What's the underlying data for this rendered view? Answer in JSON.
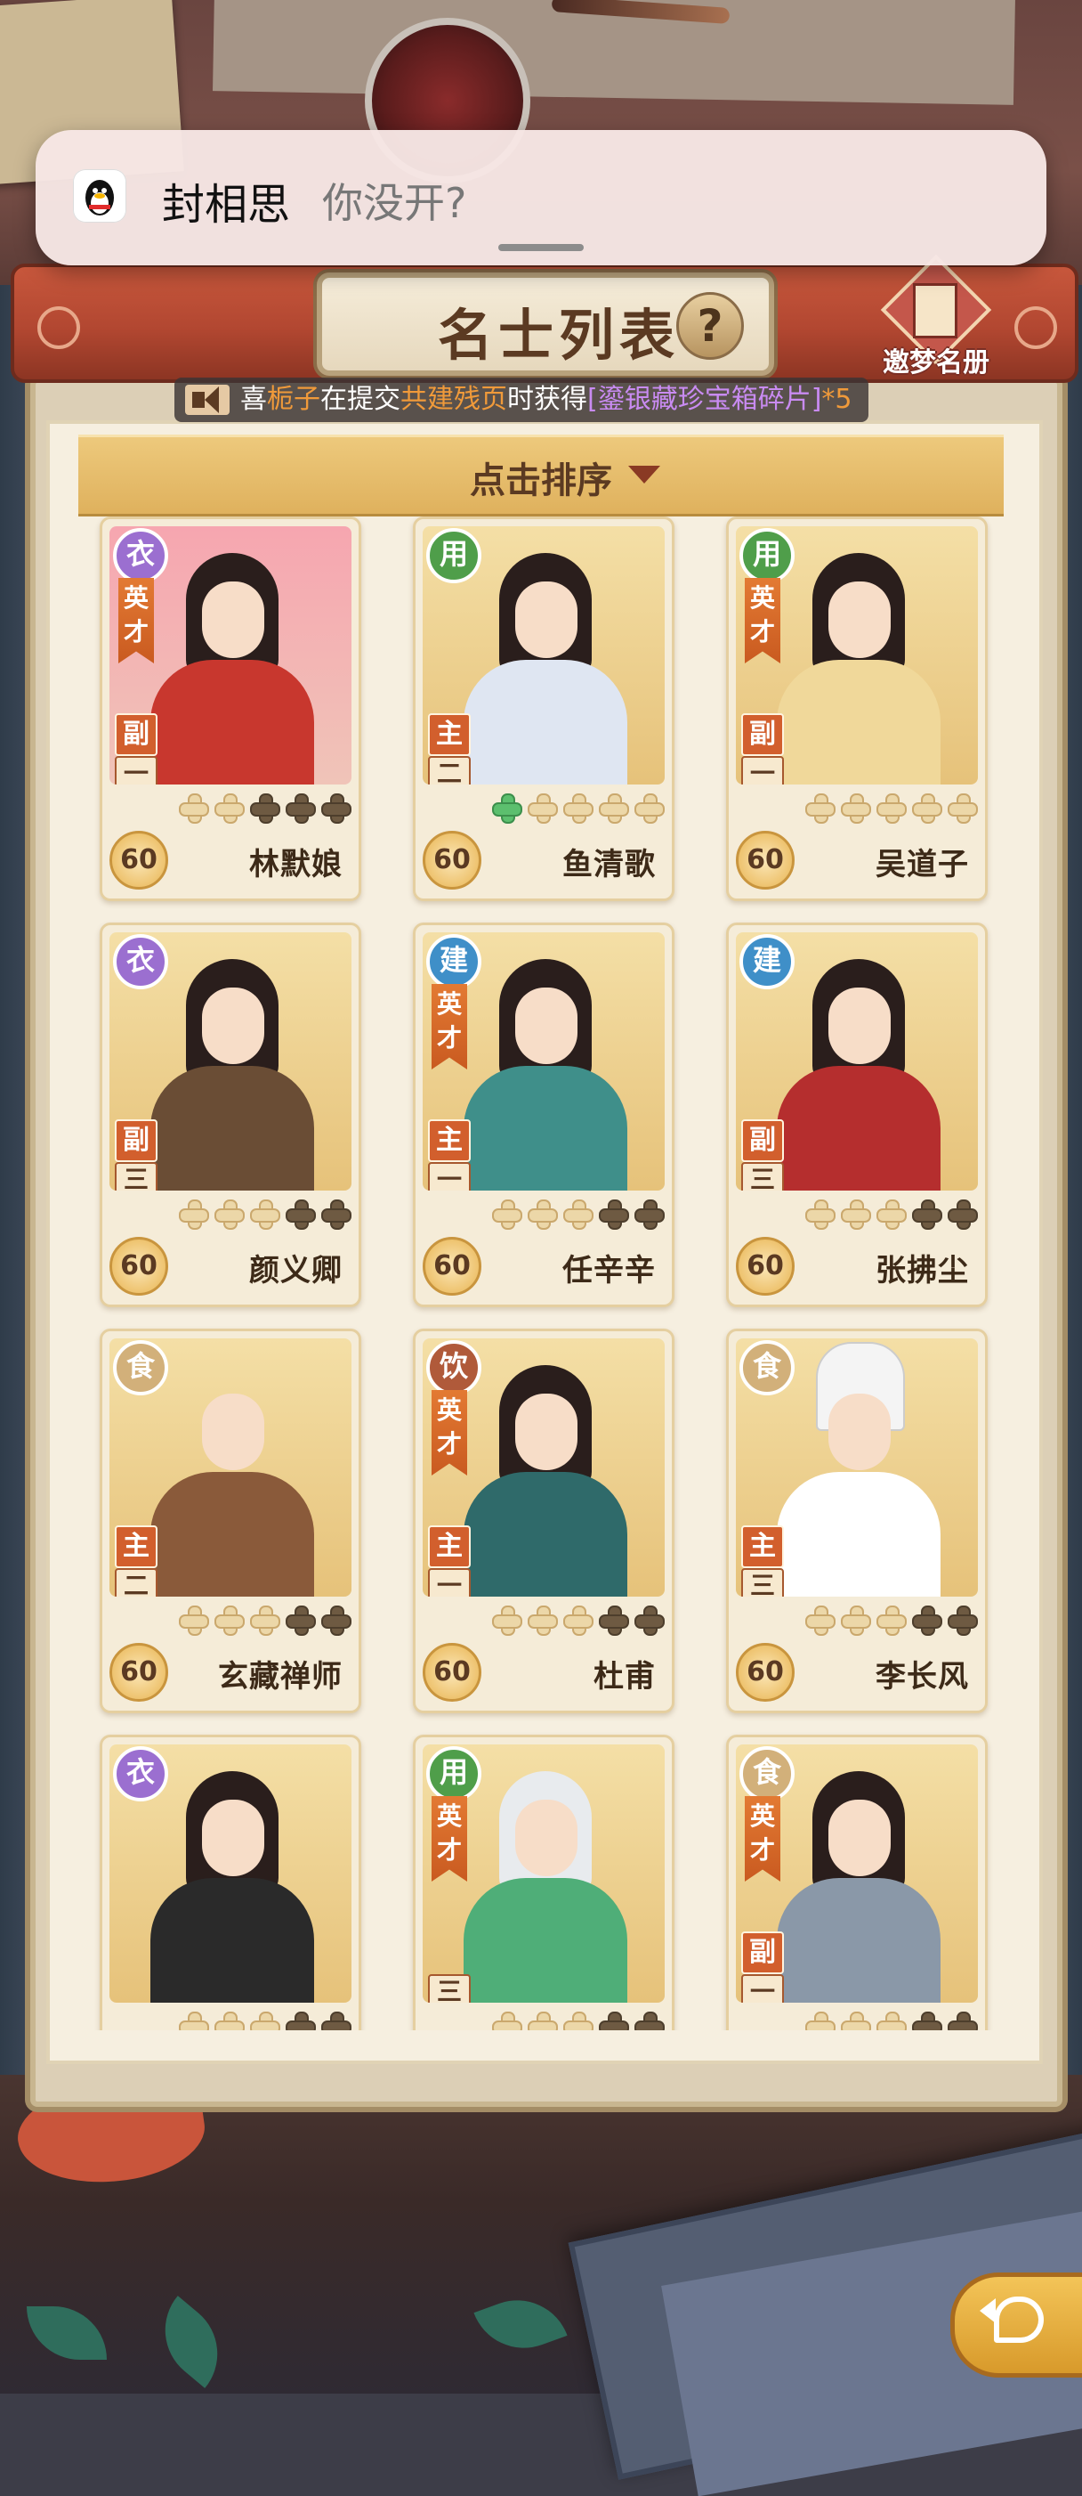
{
  "notification": {
    "sender": "封相思",
    "message": "你没开?",
    "app_icon": "qq-penguin-icon"
  },
  "header": {
    "title": "名士列表",
    "help_symbol": "?",
    "dream_register_label": "邀梦名册"
  },
  "ticker": {
    "part1": "喜",
    "name": "栀子",
    "part2": "在提交",
    "item": "共建残页",
    "part3": "时获得",
    "reward": "[鎏银藏珍宝箱碎片]",
    "part4": "*5"
  },
  "sort": {
    "label": "点击排序"
  },
  "colors": {
    "badge_clothes": "#9b6fd0",
    "badge_use": "#4f9e4a",
    "badge_build": "#3f8fc8",
    "badge_food": "#d2b07a",
    "badge_drink": "#b05a3a"
  },
  "cards": [
    {
      "name": "林默娘",
      "type": "衣",
      "type_color": "#9b6fd0",
      "talent": "英才",
      "role": "副",
      "rank": "一",
      "level": "60",
      "stars": [
        0,
        0,
        1,
        1,
        1
      ],
      "portrait": "pink",
      "body": "#c8372e",
      "hair": "dark"
    },
    {
      "name": "鱼清歌",
      "type": "用",
      "type_color": "#4f9e4a",
      "talent": "",
      "role": "主",
      "rank": "二",
      "level": "60",
      "stars": [
        2,
        0,
        0,
        0,
        0
      ],
      "portrait": "gold",
      "body": "#dfe6f2",
      "hair": "dark"
    },
    {
      "name": "吴道子",
      "type": "用",
      "type_color": "#4f9e4a",
      "talent": "英才",
      "role": "副",
      "rank": "一",
      "level": "60",
      "stars": [
        0,
        0,
        0,
        0,
        0
      ],
      "portrait": "gold",
      "body": "#f0d89a",
      "hair": "dark"
    },
    {
      "name": "颜义卿",
      "type": "衣",
      "type_color": "#9b6fd0",
      "talent": "",
      "role": "副",
      "rank": "三",
      "level": "60",
      "stars": [
        0,
        0,
        0,
        1,
        1
      ],
      "portrait": "gold",
      "body": "#6a4d35",
      "hair": "dark"
    },
    {
      "name": "任辛辛",
      "type": "建",
      "type_color": "#3f8fc8",
      "talent": "英才",
      "role": "主",
      "rank": "一",
      "level": "60",
      "stars": [
        0,
        0,
        0,
        1,
        1
      ],
      "portrait": "gold",
      "body": "#3f8f8a",
      "hair": "brown"
    },
    {
      "name": "张拂尘",
      "type": "建",
      "type_color": "#3f8fc8",
      "talent": "",
      "role": "副",
      "rank": "三",
      "level": "60",
      "stars": [
        0,
        0,
        0,
        1,
        1
      ],
      "portrait": "gold",
      "body": "#b52e2e",
      "hair": "dark"
    },
    {
      "name": "玄藏禅师",
      "type": "食",
      "type_color": "#d2b07a",
      "talent": "",
      "role": "主",
      "rank": "二",
      "level": "60",
      "stars": [
        0,
        0,
        0,
        1,
        1
      ],
      "portrait": "gold",
      "body": "#8a5a3a",
      "hair": "bald"
    },
    {
      "name": "杜甫",
      "type": "饮",
      "type_color": "#b05a3a",
      "talent": "英才",
      "role": "主",
      "rank": "一",
      "level": "60",
      "stars": [
        0,
        0,
        0,
        1,
        1
      ],
      "portrait": "gold",
      "body": "#2f6a6a",
      "hair": "dark"
    },
    {
      "name": "李长风",
      "type": "食",
      "type_color": "#d2b07a",
      "talent": "",
      "role": "主",
      "rank": "三",
      "level": "60",
      "stars": [
        0,
        0,
        0,
        1,
        1
      ],
      "portrait": "gold",
      "body": "#ffffff",
      "hair": "hat"
    },
    {
      "name": "",
      "type": "衣",
      "type_color": "#9b6fd0",
      "talent": "",
      "role": "",
      "rank": "",
      "level": "",
      "stars": [
        0,
        0,
        0,
        1,
        1
      ],
      "portrait": "gold",
      "body": "#2a2a2a",
      "hair": "dark"
    },
    {
      "name": "",
      "type": "用",
      "type_color": "#4f9e4a",
      "talent": "英才",
      "role": "",
      "rank": "三",
      "level": "",
      "stars": [
        0,
        0,
        0,
        1,
        1
      ],
      "portrait": "gold",
      "body": "#4fae78",
      "hair": "white"
    },
    {
      "name": "",
      "type": "食",
      "type_color": "#d2b07a",
      "talent": "英才",
      "role": "副",
      "rank": "一",
      "level": "",
      "stars": [
        0,
        0,
        0,
        1,
        1
      ],
      "portrait": "gold",
      "body": "#8a98a8",
      "hair": "dark"
    }
  ],
  "back_button": {
    "icon": "return-arrow-icon"
  }
}
